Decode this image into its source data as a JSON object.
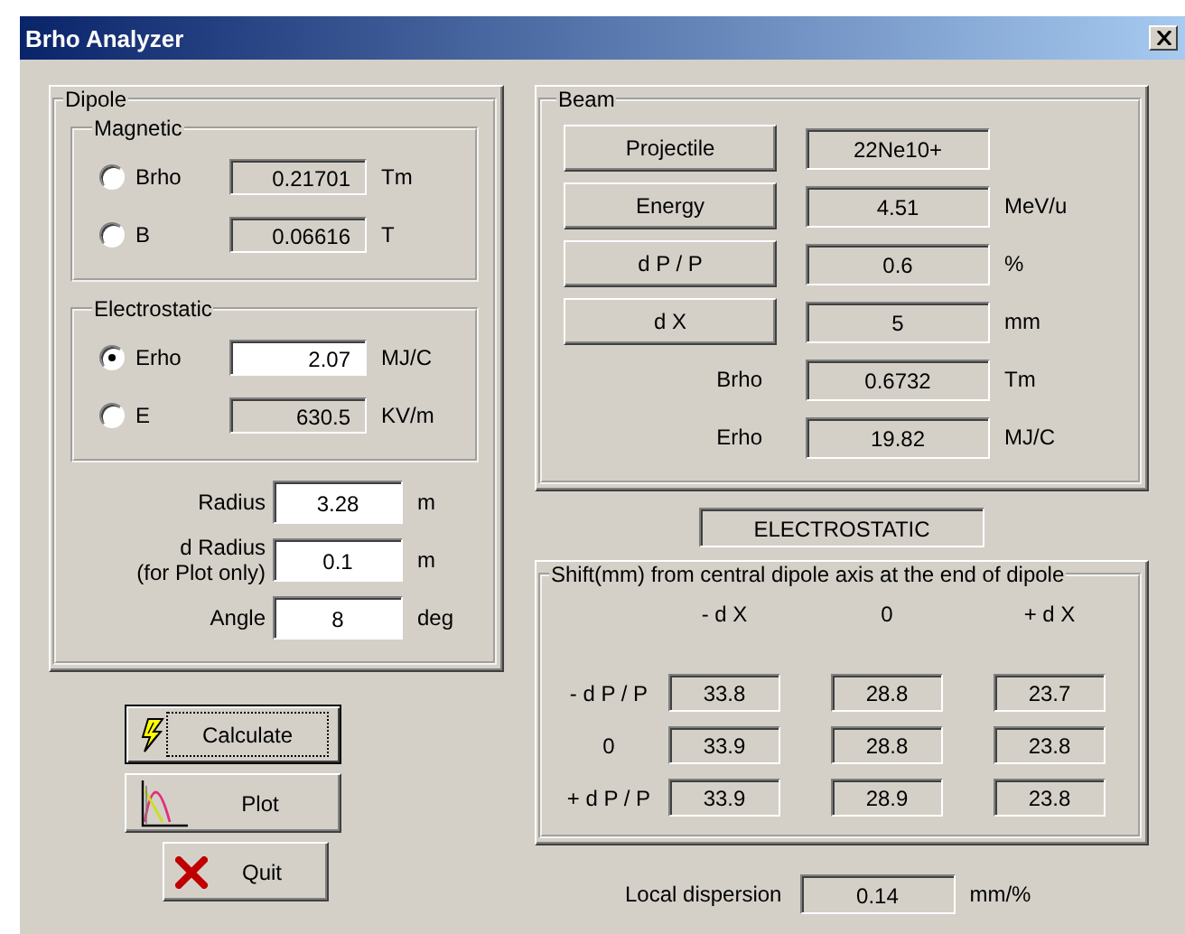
{
  "window": {
    "title": "Brho Analyzer"
  },
  "dipole": {
    "title": "Dipole",
    "groups": [
      {
        "title": "Magnetic",
        "rows": [
          {
            "label": "Brho",
            "value": "0.21701",
            "unit": "Tm",
            "selected": false,
            "readonly": true
          },
          {
            "label": "B",
            "value": "0.06616",
            "unit": "T",
            "selected": false,
            "readonly": true
          }
        ]
      },
      {
        "title": "Electrostatic",
        "rows": [
          {
            "label": "Erho",
            "value": "2.07",
            "unit": "MJ/C",
            "selected": true,
            "readonly": false
          },
          {
            "label": "E",
            "value": "630.5",
            "unit": "KV/m",
            "selected": false,
            "readonly": true
          }
        ]
      }
    ],
    "params": [
      {
        "label": "Radius",
        "value": "3.28",
        "unit": "m"
      },
      {
        "label": "d Radius",
        "note": "(for Plot only)",
        "value": "0.1",
        "unit": "m"
      },
      {
        "label": "Angle",
        "value": "8",
        "unit": "deg"
      }
    ]
  },
  "buttons": [
    {
      "kind": "calculate",
      "label": "Calculate",
      "focused": true
    },
    {
      "kind": "plot",
      "label": "Plot",
      "focused": false
    },
    {
      "kind": "quit",
      "label": "Quit",
      "focused": false
    }
  ],
  "beam": {
    "title": "Beam",
    "rows": [
      {
        "kind": "button",
        "label": "Projectile",
        "value": "22Ne10+"
      },
      {
        "kind": "button",
        "label": "Energy",
        "value": "4.51",
        "unit": "MeV/u"
      },
      {
        "kind": "button",
        "label": "d P / P",
        "value": "0.6",
        "unit": "%"
      },
      {
        "kind": "button",
        "label": "d X",
        "value": "5",
        "unit": "mm"
      },
      {
        "kind": "label",
        "label": "Brho",
        "value": "0.6732",
        "unit": "Tm"
      },
      {
        "kind": "label",
        "label": "Erho",
        "value": "19.82",
        "unit": "MJ/C"
      }
    ]
  },
  "mode": "ELECTROSTATIC",
  "shift": {
    "title": "Shift(mm) from central dipole axis at the end of dipole",
    "columns": [
      "- d X",
      "0",
      "+ d X"
    ],
    "rows": [
      {
        "label": "- d P / P",
        "values": [
          "33.8",
          "28.8",
          "23.7"
        ]
      },
      {
        "label": "0",
        "values": [
          "33.9",
          "28.8",
          "23.8"
        ]
      },
      {
        "label": "+ d P / P",
        "values": [
          "33.9",
          "28.9",
          "23.8"
        ]
      }
    ]
  },
  "dispersion": {
    "label": "Local dispersion",
    "value": "0.14",
    "unit": "mm/%"
  }
}
